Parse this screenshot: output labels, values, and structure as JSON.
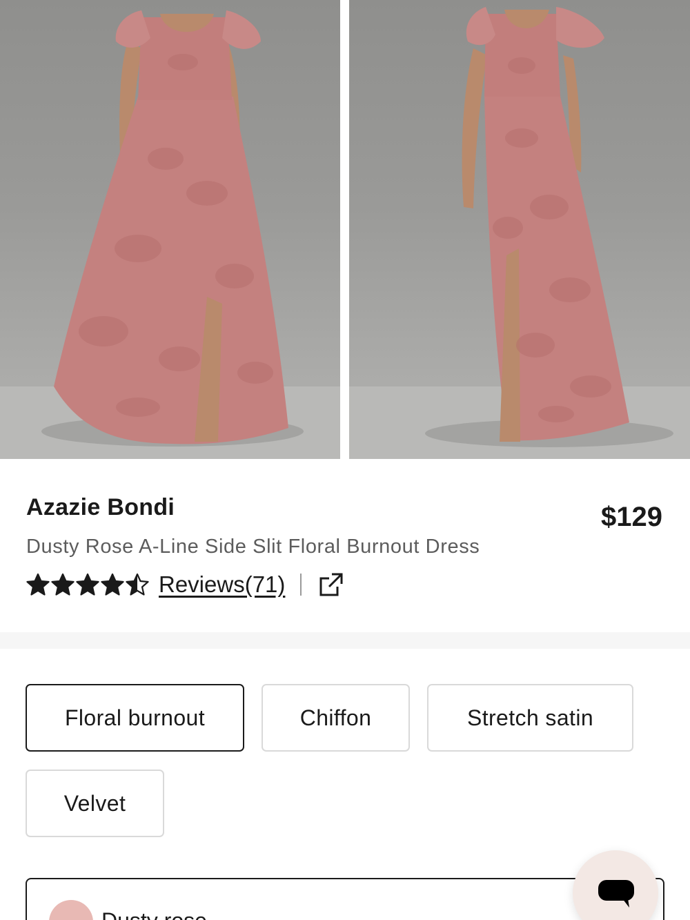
{
  "product": {
    "brand": "Azazie Bondi",
    "price": "$129",
    "subtitle": "Dusty Rose A-Line Side Slit Floral Burnout Dress",
    "rating": 4.5,
    "rating_max": 5,
    "reviews_label": "Reviews(71)"
  },
  "gallery": {
    "images": [
      {
        "name": "dress-front-view"
      },
      {
        "name": "dress-side-view"
      }
    ],
    "dress_color": "#c4817f",
    "backdrop_color": "#9a9a98"
  },
  "fabrics": {
    "options": [
      "Floral burnout",
      "Chiffon",
      "Stretch satin",
      "Velvet"
    ],
    "selected": "Floral burnout"
  },
  "color_select": {
    "value": "Dusty rose",
    "swatch_color": "#e8b9b4"
  },
  "icons": {
    "share": "external-link-icon",
    "chat": "chat-bubble-icon",
    "star": "star-icon"
  }
}
